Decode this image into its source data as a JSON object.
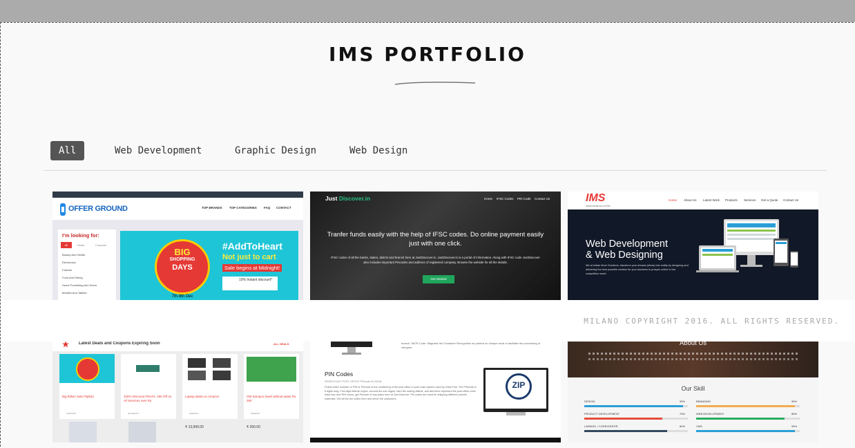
{
  "page": {
    "title": "IMS PORTFOLIO"
  },
  "filters": [
    {
      "label": "All",
      "active": true
    },
    {
      "label": "Web Development",
      "active": false
    },
    {
      "label": "Graphic Design",
      "active": false
    },
    {
      "label": "Web Design",
      "active": false
    }
  ],
  "footer": {
    "copyright": "MILANO COPYRIGHT 2016. ALL RIGHTS RESERVED."
  },
  "portfolio": {
    "offer_ground": {
      "brand": "OFFER GROUND",
      "nav": [
        "TOP BRANDS",
        "TOP CATEGORIES",
        "FAQ",
        "CONTACT"
      ],
      "looking_for": "I'm looking for:",
      "tabs": [
        "All",
        "Deals",
        "Coupons"
      ],
      "categories": [
        "Beauty And Health",
        "Electronics",
        "Fashion",
        "Food And Dining",
        "Home Furnishing And Decor",
        "Mobiles And Tablets"
      ],
      "banner_line1": "BIG",
      "banner_line2": "SHOPPING",
      "banner_line3": "DAYS",
      "banner_dates": "7th-9th Dec",
      "hashtag": "#AddToHeart",
      "tagline1": "Not just to cart",
      "tagline2": "Sale begins at Midnight!",
      "discount": "10% Instant discount*"
    },
    "just_discover": {
      "brand_a": "Just",
      "brand_b": "Discover.in",
      "nav": [
        "Home",
        "IFSC Codes",
        "PIN Code",
        "Contact Us"
      ],
      "headline1": "Tranfer funds easily with the help of IFSC codes. Do online payment easily",
      "headline2": "just with one click.",
      "body1": "IFSC codes of all the banks, states, district and branch here at JustDiscover.in. JustDiscover.in is a portal of information. Along with IFSC code JustDiscover",
      "body2": "also includes important Pincodes and address of registered company. Browse the website for all the details.",
      "cta": "Get Started"
    },
    "ims": {
      "logo": "IMS",
      "logo_sub": "INDIAN MORE SOLUTIONS",
      "nav": [
        "Home",
        "About Us",
        "Latest Work",
        "Products",
        "Services",
        "Get a Quote",
        "Contact Us"
      ],
      "headline1": "Web Development",
      "headline2": "& Web Designing",
      "body": "We at Indian More Solutions, transform your dreams (ideas) into reality by designing and delivering the best possible solution for your business to prosper online in this competitive world."
    },
    "deals": {
      "heading": "Latest Deals and Coupons Expiring Soon",
      "all_deals": "ALL DEALS",
      "cards": [
        {
          "title": "Big Billion Sale Flipkart",
          "store": "FLIPKART",
          "price": ""
        },
        {
          "title": "100% Discount Flat Rs. 200 Off on All Services over Rs.",
          "store": "HOUSEJOY",
          "price": ""
        },
        {
          "title": "Laptop deals on Amazon",
          "store": "AMAZON",
          "price": "₹ 13,990.00"
        },
        {
          "title": "OM Sampoo towel without water Rs 350",
          "store": "AMAZON",
          "price": "₹ 350.00"
        }
      ]
    },
    "pin": {
      "micr": "branch. MICR Code: Magnetic Ink Character Recognition as printed on cheque book to facilitate the processing of cheques.",
      "heading": "PIN Codes",
      "sub": "SEARCH ANY POST OFFICE PINcode IN INDIA",
      "body": "Postal Index Number or PIN or Pincode is the numbering of the post office or post code system used by India Post. The PINcode is 6 digits long. First digit reflects region, second the sub region, third the sorting district, and last three represent the post office code. India has nine PIN zones. get Pincode of any place here at Just Discover. Pin codes are used for shipping different parcels materials. Get all the pin codes here and serve the customers.",
      "zip": "ZIP"
    },
    "skills": {
      "about": "About Us",
      "heading": "Our Skill",
      "items": [
        {
          "name": "DESIGN",
          "percent": 95,
          "color": "#2a9fd6"
        },
        {
          "name": "BRANDING",
          "percent": 95,
          "color": "#f0ad4e"
        },
        {
          "name": "PRODUCT DEVELOPMENT",
          "percent": 75,
          "color": "#e74c3c"
        },
        {
          "name": "WEB DEVELOPMENT",
          "percent": 85,
          "color": "#27ae60"
        },
        {
          "name": "LARAVEL / CODEIGNITER",
          "percent": 80,
          "color": "#34495e"
        },
        {
          "name": "CMS",
          "percent": 95,
          "color": "#2a9fd6"
        }
      ]
    }
  }
}
